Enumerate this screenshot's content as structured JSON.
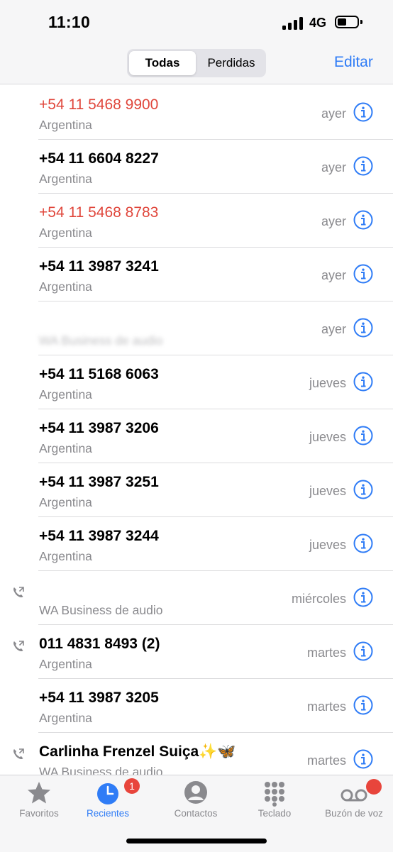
{
  "status": {
    "time": "11:10",
    "network": "4G",
    "battery_level": 0.45
  },
  "header": {
    "segments": [
      "Todas",
      "Perdidas"
    ],
    "selected_segment": "Todas",
    "edit_label": "Editar"
  },
  "calls": [
    {
      "name": "+54 11 5468 9900",
      "subtitle": "Argentina",
      "when": "ayer",
      "missed": true,
      "outgoing": false,
      "obscured": false
    },
    {
      "name": "+54 11 6604 8227",
      "subtitle": "Argentina",
      "when": "ayer",
      "missed": false,
      "outgoing": false,
      "obscured": false
    },
    {
      "name": "+54 11 5468 8783",
      "subtitle": "Argentina",
      "when": "ayer",
      "missed": true,
      "outgoing": false,
      "obscured": false
    },
    {
      "name": "+54 11 3987 3241",
      "subtitle": "Argentina",
      "when": "ayer",
      "missed": false,
      "outgoing": false,
      "obscured": false
    },
    {
      "name": "",
      "subtitle": "WA Business de audio",
      "when": "ayer",
      "missed": false,
      "outgoing": false,
      "obscured": true
    },
    {
      "name": "+54 11 5168 6063",
      "subtitle": "Argentina",
      "when": "jueves",
      "missed": false,
      "outgoing": false,
      "obscured": false
    },
    {
      "name": "+54 11 3987 3206",
      "subtitle": "Argentina",
      "when": "jueves",
      "missed": false,
      "outgoing": false,
      "obscured": false
    },
    {
      "name": "+54 11 3987 3251",
      "subtitle": "Argentina",
      "when": "jueves",
      "missed": false,
      "outgoing": false,
      "obscured": false
    },
    {
      "name": "+54 11 3987 3244",
      "subtitle": "Argentina",
      "when": "jueves",
      "missed": false,
      "outgoing": false,
      "obscured": false
    },
    {
      "name": "",
      "subtitle": "WA Business de audio",
      "when": "miércoles",
      "missed": false,
      "outgoing": true,
      "obscured": true
    },
    {
      "name": "011 4831 8493 (2)",
      "subtitle": "Argentina",
      "when": "martes",
      "missed": false,
      "outgoing": true,
      "obscured": false
    },
    {
      "name": "+54 11 3987 3205",
      "subtitle": "Argentina",
      "when": "martes",
      "missed": false,
      "outgoing": false,
      "obscured": false
    },
    {
      "name": "Carlinha Frenzel Suiça✨🦋",
      "subtitle": "WA Business de audio",
      "when": "martes",
      "missed": false,
      "outgoing": true,
      "obscured": false
    }
  ],
  "tabs": [
    {
      "label": "Favoritos",
      "icon": "star-icon",
      "active": false,
      "badge": ""
    },
    {
      "label": "Recientes",
      "icon": "clock-icon",
      "active": true,
      "badge": "1"
    },
    {
      "label": "Contactos",
      "icon": "person-icon",
      "active": false,
      "badge": ""
    },
    {
      "label": "Teclado",
      "icon": "keypad-icon",
      "active": false,
      "badge": ""
    },
    {
      "label": "Buzón de voz",
      "icon": "voicemail-icon",
      "active": false,
      "badge": "•"
    }
  ],
  "colors": {
    "accent": "#2f7cf6",
    "missed": "#e0463b",
    "badge": "#e8453c",
    "secondary_text": "#8a8a8e"
  }
}
